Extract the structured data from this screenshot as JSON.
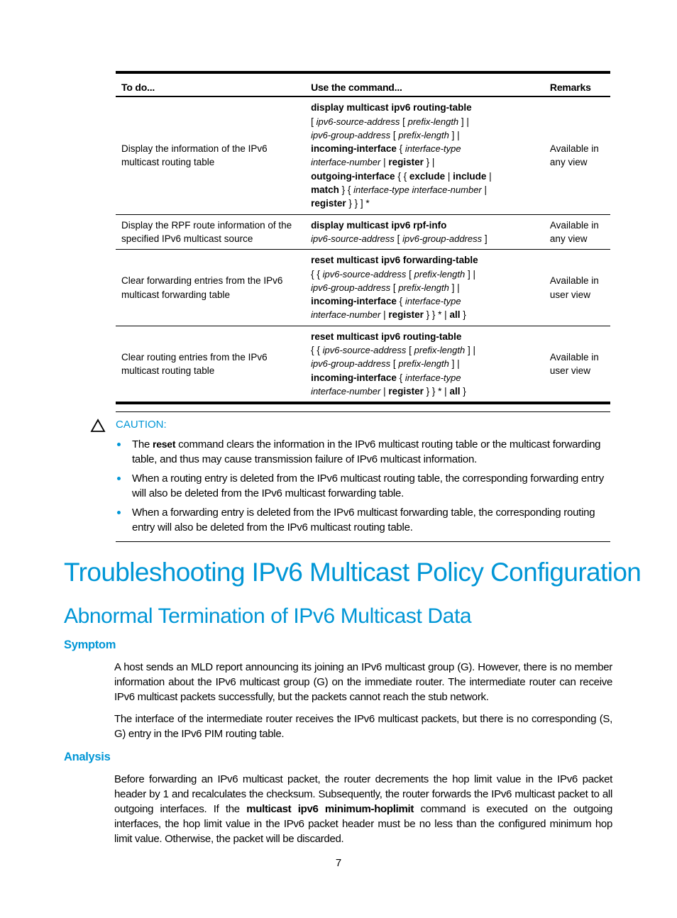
{
  "table": {
    "headers": [
      "To do...",
      "Use the command...",
      "Remarks"
    ],
    "rows": [
      {
        "todo": [
          "Display the information of the IPv6",
          "multicast routing table"
        ],
        "command_lines": [
          [
            {
              "t": "display multicast ipv6 routing-table",
              "s": "b"
            }
          ],
          [
            {
              "t": "[ ",
              "s": "n"
            },
            {
              "t": "ipv6-source-address",
              "s": "i"
            },
            {
              "t": " [ ",
              "s": "n"
            },
            {
              "t": "prefix-length",
              "s": "i"
            },
            {
              "t": " ] |",
              "s": "n"
            }
          ],
          [
            {
              "t": "ipv6-group-address",
              "s": "i"
            },
            {
              "t": " [ ",
              "s": "n"
            },
            {
              "t": "prefix-length",
              "s": "i"
            },
            {
              "t": " ] |",
              "s": "n"
            }
          ],
          [
            {
              "t": "incoming-interface",
              "s": "b"
            },
            {
              "t": " { ",
              "s": "n"
            },
            {
              "t": "interface-type",
              "s": "i"
            }
          ],
          [
            {
              "t": "interface-number",
              "s": "i"
            },
            {
              "t": " | ",
              "s": "n"
            },
            {
              "t": "register",
              "s": "b"
            },
            {
              "t": " } |",
              "s": "n"
            }
          ],
          [
            {
              "t": "outgoing-interface",
              "s": "b"
            },
            {
              "t": " { { ",
              "s": "n"
            },
            {
              "t": "exclude",
              "s": "b"
            },
            {
              "t": " | ",
              "s": "n"
            },
            {
              "t": "include",
              "s": "b"
            },
            {
              "t": " |",
              "s": "n"
            }
          ],
          [
            {
              "t": "match",
              "s": "b"
            },
            {
              "t": " } { ",
              "s": "n"
            },
            {
              "t": "interface-type interface-number",
              "s": "i"
            },
            {
              "t": " |",
              "s": "n"
            }
          ],
          [
            {
              "t": "register",
              "s": "b"
            },
            {
              "t": " } } ] *",
              "s": "n"
            }
          ]
        ],
        "remarks": [
          "Available in",
          "any view"
        ]
      },
      {
        "todo": [
          "Display the RPF route information of the",
          "specified IPv6 multicast source"
        ],
        "command_lines": [
          [
            {
              "t": "display multicast ipv6 rpf-info",
              "s": "b"
            }
          ],
          [
            {
              "t": "ipv6-source-address",
              "s": "i"
            },
            {
              "t": " [ ",
              "s": "n"
            },
            {
              "t": "ipv6-group-address",
              "s": "i"
            },
            {
              "t": " ]",
              "s": "n"
            }
          ]
        ],
        "remarks": [
          "Available in",
          "any view"
        ]
      },
      {
        "todo": [
          "Clear forwarding entries from the IPv6",
          "multicast forwarding table"
        ],
        "command_lines": [
          [
            {
              "t": "reset multicast ipv6 forwarding-table",
              "s": "b"
            }
          ],
          [
            {
              "t": "{ { ",
              "s": "n"
            },
            {
              "t": "ipv6-source-address",
              "s": "i"
            },
            {
              "t": " [ ",
              "s": "n"
            },
            {
              "t": "prefix-length",
              "s": "i"
            },
            {
              "t": " ] |",
              "s": "n"
            }
          ],
          [
            {
              "t": "ipv6-group-address",
              "s": "i"
            },
            {
              "t": " [ ",
              "s": "n"
            },
            {
              "t": "prefix-length",
              "s": "i"
            },
            {
              "t": " ] |",
              "s": "n"
            }
          ],
          [
            {
              "t": "incoming-interface",
              "s": "b"
            },
            {
              "t": " { ",
              "s": "n"
            },
            {
              "t": "interface-type",
              "s": "i"
            }
          ],
          [
            {
              "t": "interface-number",
              "s": "i"
            },
            {
              "t": " | ",
              "s": "n"
            },
            {
              "t": "register",
              "s": "b"
            },
            {
              "t": " } } * | ",
              "s": "n"
            },
            {
              "t": "all",
              "s": "b"
            },
            {
              "t": " }",
              "s": "n"
            }
          ]
        ],
        "remarks": [
          "Available in",
          "user view"
        ]
      },
      {
        "todo": [
          "Clear routing entries from the IPv6",
          "multicast routing table"
        ],
        "command_lines": [
          [
            {
              "t": "reset multicast ipv6 routing-table",
              "s": "b"
            }
          ],
          [
            {
              "t": "{ { ",
              "s": "n"
            },
            {
              "t": "ipv6-source-address",
              "s": "i"
            },
            {
              "t": " [ ",
              "s": "n"
            },
            {
              "t": "prefix-length",
              "s": "i"
            },
            {
              "t": " ] |",
              "s": "n"
            }
          ],
          [
            {
              "t": "ipv6-group-address",
              "s": "i"
            },
            {
              "t": " [ ",
              "s": "n"
            },
            {
              "t": "prefix-length",
              "s": "i"
            },
            {
              "t": " ] |",
              "s": "n"
            }
          ],
          [
            {
              "t": "incoming-interface",
              "s": "b"
            },
            {
              "t": " { ",
              "s": "n"
            },
            {
              "t": "interface-type",
              "s": "i"
            }
          ],
          [
            {
              "t": "interface-number",
              "s": "i"
            },
            {
              "t": " | ",
              "s": "n"
            },
            {
              "t": "register",
              "s": "b"
            },
            {
              "t": " } } * | ",
              "s": "n"
            },
            {
              "t": "all",
              "s": "b"
            },
            {
              "t": " }",
              "s": "n"
            }
          ]
        ],
        "remarks": [
          "Available in",
          "user view"
        ]
      }
    ]
  },
  "caution": {
    "icon": "warning-triangle-icon",
    "title": "CAUTION:",
    "items": [
      {
        "before": "The ",
        "bold": "reset",
        "after": " command clears the information in the IPv6 multicast routing table or the multicast forwarding table, and thus may cause transmission failure of IPv6 multicast information."
      },
      {
        "before": "When a routing entry is deleted from the IPv6 multicast routing table, the corresponding forwarding entry will also be deleted from the IPv6 multicast forwarding table.",
        "bold": "",
        "after": ""
      },
      {
        "before": "When a forwarding entry is deleted from the IPv6 multicast forwarding table, the corresponding routing entry will also be deleted from the IPv6 multicast routing table.",
        "bold": "",
        "after": ""
      }
    ]
  },
  "section": {
    "title": "Troubleshooting IPv6 Multicast Policy Configuration",
    "subtitle": "Abnormal Termination of IPv6 Multicast Data",
    "symptom": {
      "heading": "Symptom",
      "p1": "A host sends an MLD report announcing its joining an IPv6 multicast group (G). However, there is no member information about the IPv6 multicast group (G) on the immediate router. The intermediate router can receive IPv6 multicast packets successfully, but the packets cannot reach the stub network.",
      "p2": "The interface of the intermediate router receives the IPv6 multicast packets, but there is no corresponding (S, G) entry in the IPv6 PIM routing table."
    },
    "analysis": {
      "heading": "Analysis",
      "p1_before": "Before forwarding an IPv6 multicast packet, the router decrements the hop limit value in the IPv6 packet header by 1 and recalculates the checksum. Subsequently, the router forwards the IPv6 multicast packet to all outgoing interfaces. If the ",
      "p1_bold": "multicast ipv6 minimum-hoplimit",
      "p1_after": " command is executed on the outgoing interfaces, the hop limit value in the IPv6 packet header must be no less than the configured minimum hop limit value. Otherwise, the packet will be discarded."
    }
  },
  "page_number": "7",
  "colors": {
    "accent": "#0096d6",
    "text": "#000000"
  }
}
